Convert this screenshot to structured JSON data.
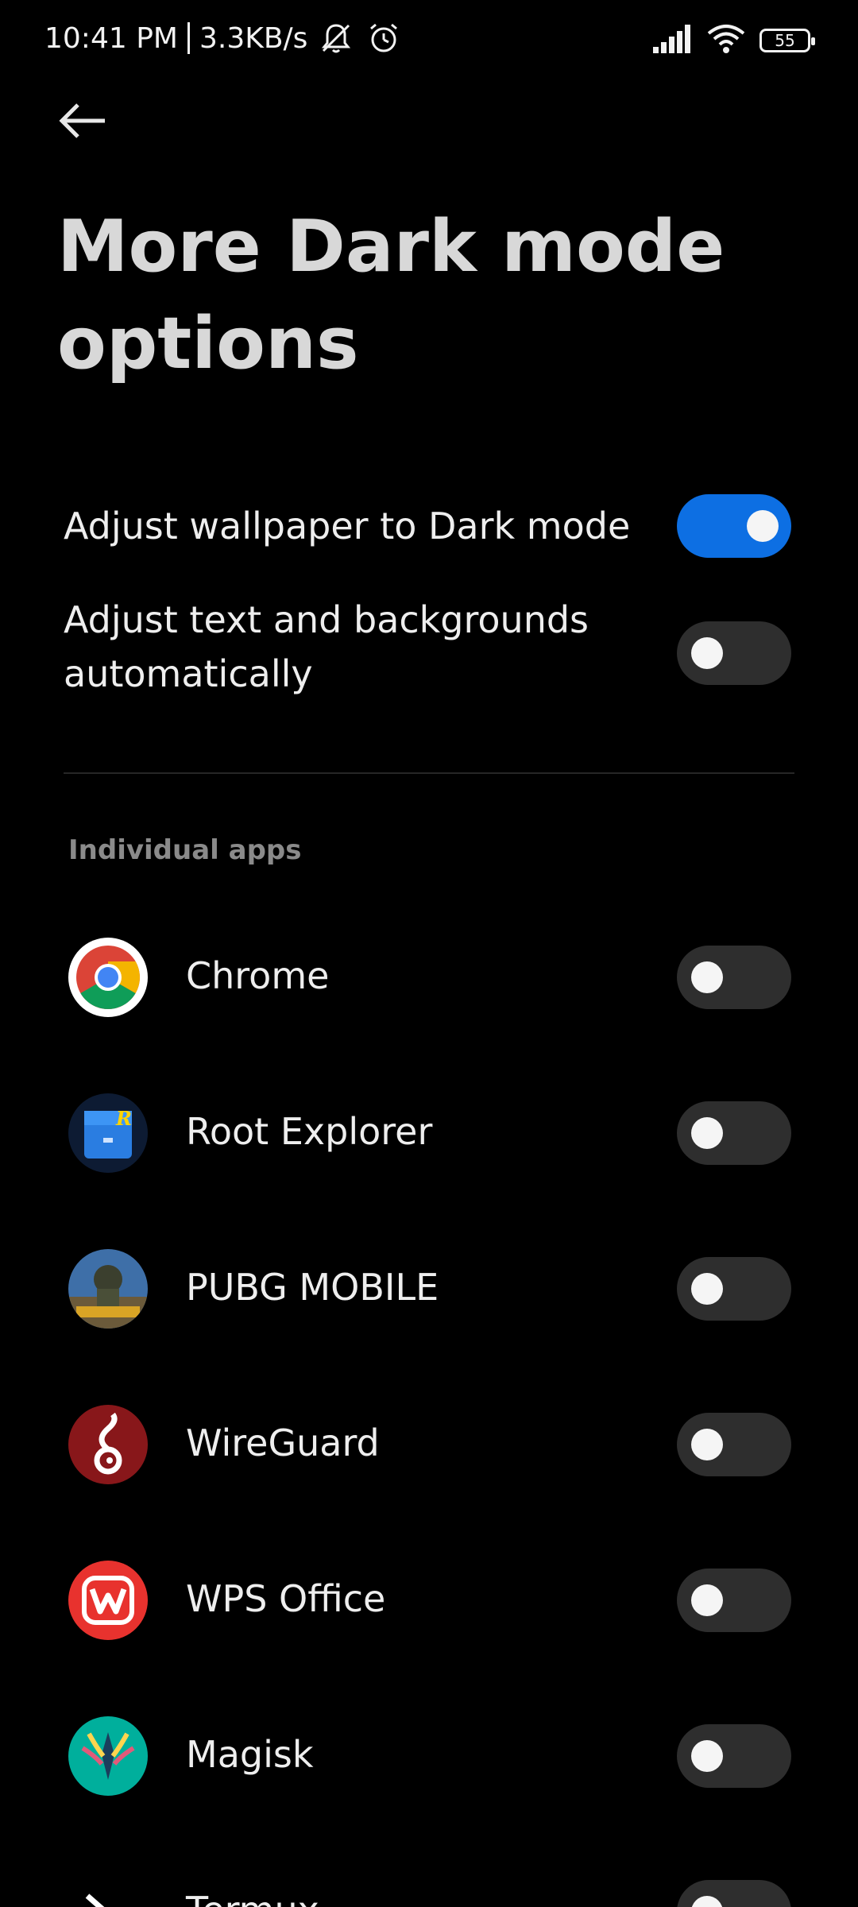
{
  "status_bar": {
    "time": "10:41 PM",
    "network_speed": "3.3KB/s",
    "battery_level": "55",
    "icons": [
      "muted-bell-icon",
      "alarm-icon",
      "signal-icon",
      "wifi-icon",
      "battery-icon"
    ]
  },
  "header": {
    "back_icon": "back-arrow-icon",
    "title": "More Dark mode options"
  },
  "settings": [
    {
      "label": "Adjust wallpaper to Dark mode",
      "enabled": true
    },
    {
      "label": "Adjust text and backgrounds automatically",
      "enabled": false
    }
  ],
  "section": {
    "title": "Individual apps"
  },
  "apps": [
    {
      "name": "Chrome",
      "icon": "chrome-icon",
      "enabled": false
    },
    {
      "name": "Root Explorer",
      "icon": "root-explorer-icon",
      "enabled": false
    },
    {
      "name": "PUBG MOBILE",
      "icon": "pubg-mobile-icon",
      "enabled": false
    },
    {
      "name": "WireGuard",
      "icon": "wireguard-icon",
      "enabled": false
    },
    {
      "name": "WPS Office",
      "icon": "wps-office-icon",
      "enabled": false
    },
    {
      "name": "Magisk",
      "icon": "magisk-icon",
      "enabled": false
    },
    {
      "name": "Termux",
      "icon": "termux-icon",
      "enabled": false
    }
  ],
  "colors": {
    "background": "#000000",
    "toggle_on": "#0d6fe3",
    "toggle_off": "#2e2e2e",
    "section_header": "#8a8a8a"
  }
}
